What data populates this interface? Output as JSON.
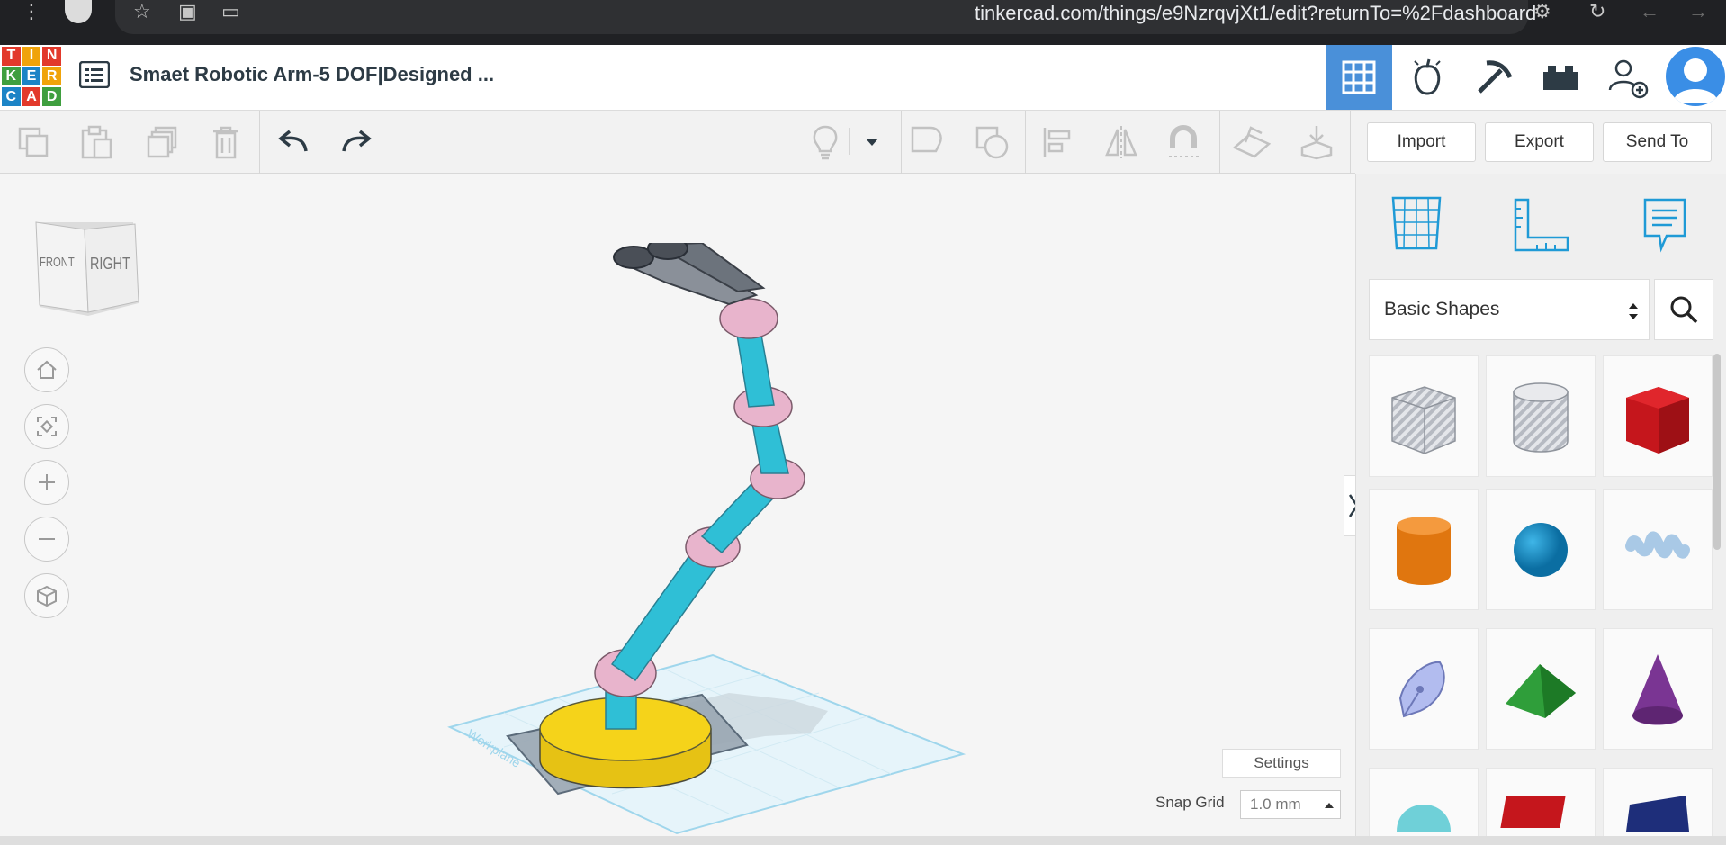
{
  "browser": {
    "url": "tinkercad.com/things/e9NzrqvjXt1/edit?returnTo=%2Fdashboard"
  },
  "logo": {
    "letters": [
      "T",
      "I",
      "N",
      "K",
      "E",
      "R",
      "C",
      "A",
      "D"
    ],
    "colors": [
      "#e2392b",
      "#f0a30a",
      "#e2392b",
      "#3f9f3f",
      "#1c84c6",
      "#f0a30a",
      "#1c84c6",
      "#e2392b",
      "#3f9f3f"
    ]
  },
  "design": {
    "title": "Smaet Robotic Arm-5 DOF|Designed ..."
  },
  "header_buttons": {
    "import": "Import",
    "export": "Export",
    "send_to": "Send To"
  },
  "view_cube": {
    "front": "FRONT",
    "right": "RIGHT"
  },
  "panel": {
    "library_select": "Basic Shapes"
  },
  "workplane": {
    "label": "Workplane"
  },
  "footer": {
    "settings": "Settings",
    "snap_grid_label": "Snap Grid",
    "snap_grid_value": "1.0 mm"
  },
  "colors": {
    "accent": "#4a90d9",
    "shape_pink": "#e8b4cc",
    "shape_cyan": "#2fbfd6",
    "shape_yellow": "#f5d31a"
  }
}
